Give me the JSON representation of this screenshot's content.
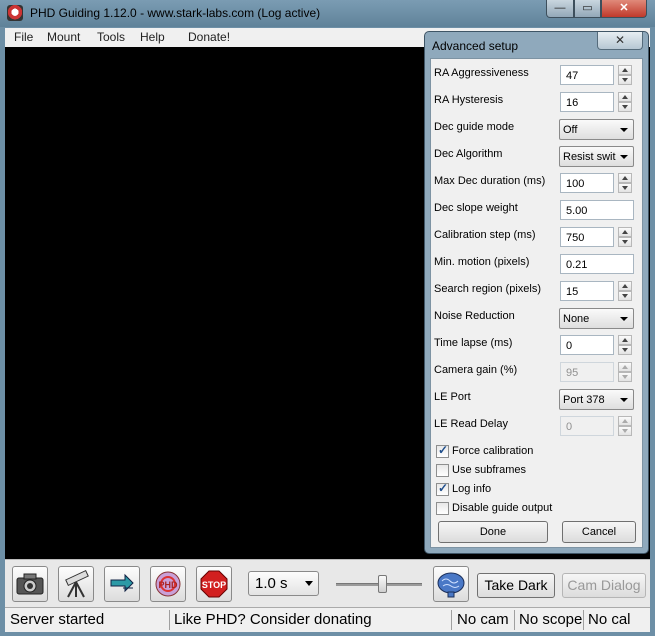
{
  "window": {
    "title": "PHD Guiding 1.12.0  -  www.stark-labs.com (Log active)"
  },
  "titlebar": {
    "minimize": "—",
    "maximize": "▭",
    "close": "✕"
  },
  "menu": [
    "File",
    "Mount",
    "Tools",
    "Help",
    "Donate!"
  ],
  "toolbar": {
    "exposure": "1.0 s",
    "take_dark": "Take Dark",
    "cam_dialog": "Cam Dialog",
    "icons": [
      "camera-icon",
      "telescope-icon",
      "loop-icon",
      "phd-guide-icon",
      "stop-icon",
      "brain-icon"
    ],
    "gamma_level": 0.55
  },
  "status": {
    "left": "Server started",
    "middle": "Like PHD? Consider donating",
    "cam": "No cam",
    "scope": "No scope",
    "cal": "No cal"
  },
  "dialog": {
    "title": "Advanced setup",
    "close": "✕",
    "rows": [
      {
        "label": "RA Aggressiveness",
        "value": "47"
      },
      {
        "label": "RA Hysteresis",
        "value": "16"
      },
      {
        "label": "Dec guide mode",
        "value": "Off"
      },
      {
        "label": "Dec Algorithm",
        "value": "Resist swit"
      },
      {
        "label": "Max Dec duration (ms)",
        "value": "100"
      },
      {
        "label": "Dec slope weight",
        "value": "5.00"
      },
      {
        "label": "Calibration step (ms)",
        "value": "750"
      },
      {
        "label": "Min. motion (pixels)",
        "value": "0.21"
      },
      {
        "label": "Search region (pixels)",
        "value": "15"
      },
      {
        "label": "Noise Reduction",
        "value": "None"
      },
      {
        "label": "Time lapse (ms)",
        "value": "0"
      },
      {
        "label": "Camera gain (%)",
        "value": "95"
      },
      {
        "label": "LE Port",
        "value": "Port 378"
      },
      {
        "label": "LE Read Delay",
        "value": "0"
      }
    ],
    "checks": [
      {
        "label": "Force calibration",
        "checked": true
      },
      {
        "label": "Use subframes",
        "checked": false
      },
      {
        "label": "Log info",
        "checked": true
      },
      {
        "label": "Disable guide output",
        "checked": false
      }
    ],
    "done": "Done",
    "cancel": "Cancel"
  }
}
